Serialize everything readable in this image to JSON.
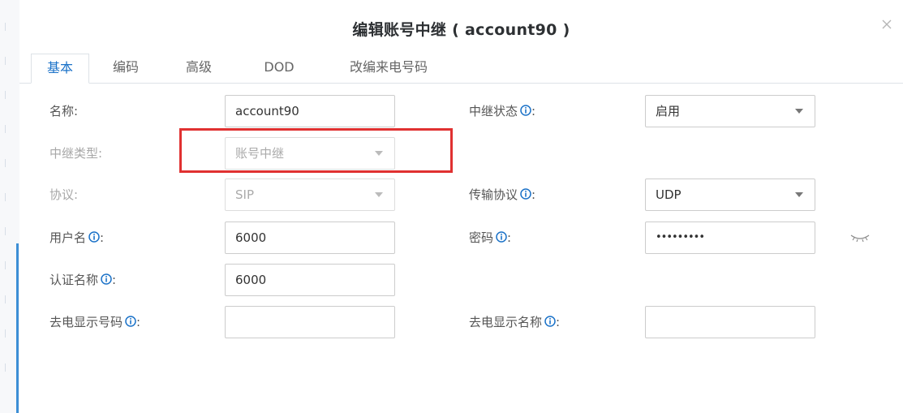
{
  "dialog": {
    "title": "编辑账号中继 ( account90 )",
    "tabs": [
      "基本",
      "编码",
      "高级",
      "DOD",
      "改编来电号码"
    ],
    "active_tab": "基本"
  },
  "form": {
    "name_label": "名称:",
    "name_value": "account90",
    "trunk_status_label": "中继状态",
    "trunk_status_value": "启用",
    "trunk_type_label": "中继类型:",
    "trunk_type_value": "账号中继",
    "protocol_label": "协议:",
    "protocol_value": "SIP",
    "transport_label": "传输协议",
    "transport_value": "UDP",
    "username_label": "用户名",
    "username_value": "6000",
    "password_label": "密码",
    "password_value": "•••••••••",
    "auth_name_label": "认证名称",
    "auth_name_value": "6000",
    "callerid_number_label": "去电显示号码",
    "callerid_number_value": "",
    "callerid_name_label": "去电显示名称",
    "callerid_name_value": ""
  },
  "icons": {
    "info": "info-icon",
    "close": "close-icon",
    "eye": "eye-closed-icon",
    "dropdown": "chevron-down-icon"
  },
  "colors": {
    "accent": "#1b72c8",
    "highlight": "#e03131"
  }
}
